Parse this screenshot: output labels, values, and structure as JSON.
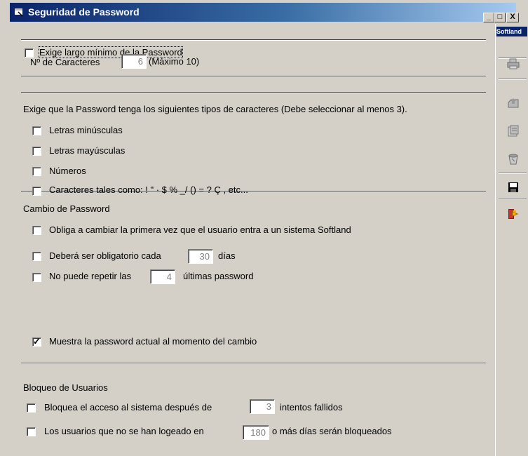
{
  "window": {
    "title": "Seguridad de Password",
    "brand": "Softland",
    "minimize": "_",
    "maximize": "□",
    "close": "X"
  },
  "length_section": {
    "require_min_length": {
      "label": "Exige largo mínimo de la Password",
      "checked": false
    },
    "char_count_label": "Nº de Caracteres",
    "char_count_value": "6",
    "char_count_max": "(Máximo 10)"
  },
  "char_types_section": {
    "heading": "Exige que la Password tenga los siguientes tipos de caracteres (Debe seleccionar al menos 3).",
    "options": [
      {
        "label": "Letras minúsculas",
        "checked": false
      },
      {
        "label": "Letras mayúsculas",
        "checked": false
      },
      {
        "label": "Números",
        "checked": false
      },
      {
        "label": "Caracteres tales como:  ! \" · $ % _/ () = ? Ç  , etc...",
        "checked": false
      }
    ]
  },
  "change_section": {
    "heading": "Cambio de Password",
    "force_first_change": {
      "label": "Obliga a cambiar la primera vez que el usuario entra a un sistema Softland",
      "checked": false
    },
    "mandatory_every": {
      "label": "Deberá ser obligatorio cada",
      "value": "30",
      "suffix": "días",
      "checked": false
    },
    "no_repeat": {
      "label": "No puede repetir las",
      "value": "4",
      "suffix": "últimas password",
      "checked": false
    },
    "show_current": {
      "label": "Muestra la password actual al momento del cambio",
      "checked": true
    }
  },
  "lock_section": {
    "heading": "Bloqueo de Usuarios",
    "block_after_attempts": {
      "label": "Bloquea el acceso al sistema después de",
      "value": "3",
      "suffix": "intentos fallidos",
      "checked": false
    },
    "block_inactive": {
      "label": "Los usuarios que no se han  logeado en",
      "value": "180",
      "suffix": "o más días serán bloqueados",
      "checked": false
    }
  },
  "toolbar": {
    "icons": [
      "printer-icon",
      "import-icon",
      "properties-icon",
      "refresh-icon",
      "save-icon",
      "exit-icon"
    ]
  }
}
